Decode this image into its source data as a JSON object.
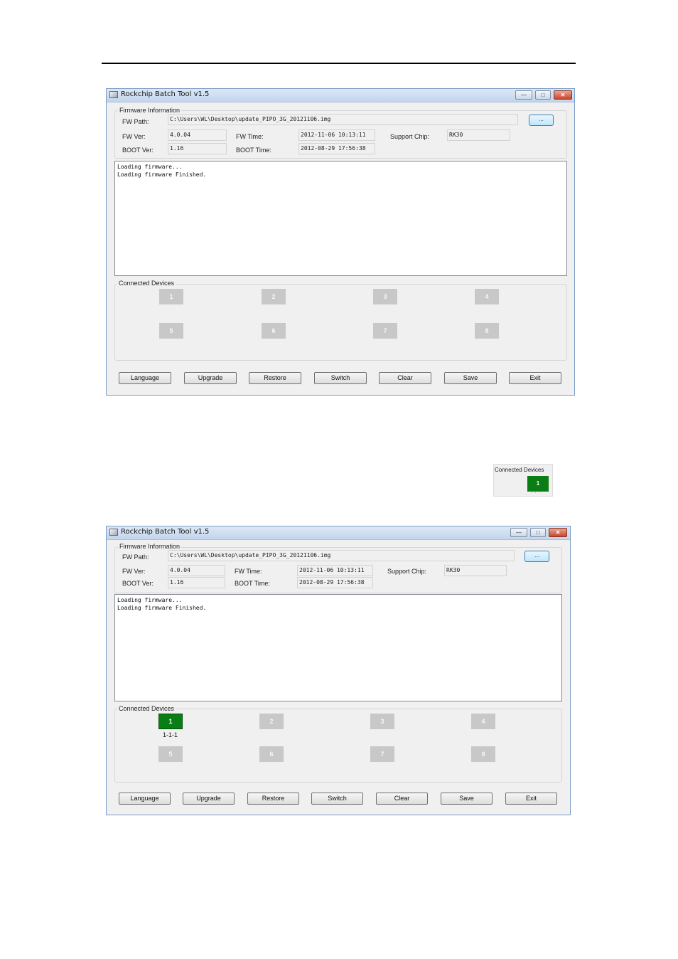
{
  "window_title": "Rockchip Batch Tool v1.5",
  "window_controls": {
    "minimize": "—",
    "maximize": "□",
    "close": "✕"
  },
  "firmware_group_label": "Firmware Information",
  "labels": {
    "fw_path": "FW Path:",
    "fw_ver": "FW Ver:",
    "boot_ver": "BOOT Ver:",
    "fw_time": "FW Time:",
    "boot_time": "BOOT Time:",
    "support_chip": "Support Chip:"
  },
  "values": {
    "fw_path": "C:\\Users\\WL\\Desktop\\update_PIPO_3G_20121106.img",
    "fw_ver": "4.0.04",
    "boot_ver": "1.16",
    "fw_time": "2012-11-06 10:13:11",
    "boot_time": "2012-08-29 17:56:38",
    "support_chip": "RK30"
  },
  "browse_label": "...",
  "log_lines": [
    "Loading firmware...",
    "Loading firmware Finished."
  ],
  "devices_group_label": "Connected Devices",
  "devices": [
    "1",
    "2",
    "3",
    "4",
    "5",
    "6",
    "7",
    "8"
  ],
  "connected_device": {
    "number": "1",
    "location": "1-1-1",
    "status_color": "#0a7d15"
  },
  "buttons": [
    "Language",
    "Upgrade",
    "Restore",
    "Switch",
    "Clear",
    "Save",
    "Exit"
  ],
  "mini_snippet": {
    "label": "Connected Devices",
    "device": "1",
    "trailing": "· · ·"
  },
  "colors": {
    "device_idle": "#c8c8c8",
    "device_connected": "#0a7d15",
    "titlebar": "#c3d5ec"
  }
}
